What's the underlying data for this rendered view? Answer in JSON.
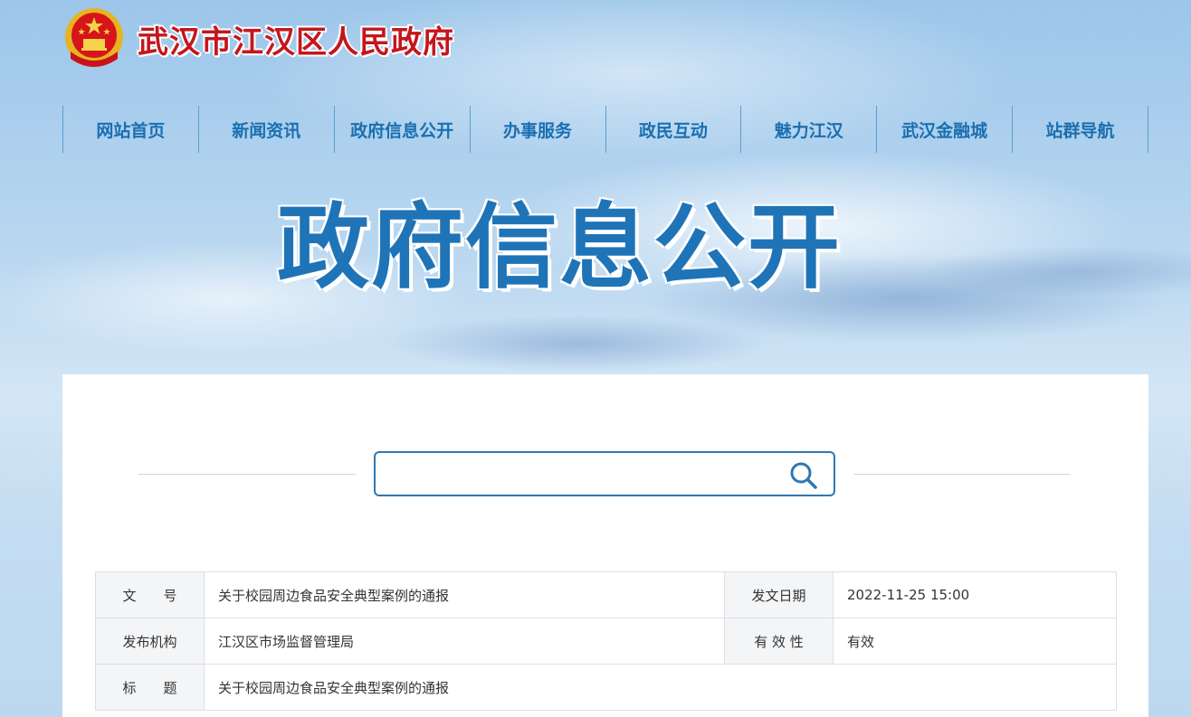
{
  "header": {
    "site_title": "武汉市江汉区人民政府",
    "emblem_icon": "national-emblem-icon"
  },
  "nav": {
    "items": [
      {
        "label": "网站首页"
      },
      {
        "label": "新闻资讯"
      },
      {
        "label": "政府信息公开"
      },
      {
        "label": "办事服务"
      },
      {
        "label": "政民互动"
      },
      {
        "label": "魅力江汉"
      },
      {
        "label": "武汉金融城"
      },
      {
        "label": "站群导航"
      }
    ]
  },
  "banner": {
    "title": "政府信息公开"
  },
  "search": {
    "value": "",
    "placeholder": "",
    "icon": "search-icon"
  },
  "info": {
    "doc_no_label": "文　　号",
    "doc_no_value": "关于校园周边食品安全典型案例的通报",
    "date_label": "发文日期",
    "date_value": "2022-11-25 15:00",
    "issuer_label": "发布机构",
    "issuer_value": "江汉区市场监督管理局",
    "validity_label": "有 效 性",
    "validity_value": "有效",
    "title_label": "标　　题",
    "title_value": "关于校园周边食品安全典型案例的通报"
  },
  "colors": {
    "nav_text": "#1a6fb0",
    "site_title": "#c4161c",
    "banner_title": "#1f74b8",
    "search_border": "#2f77b3"
  }
}
